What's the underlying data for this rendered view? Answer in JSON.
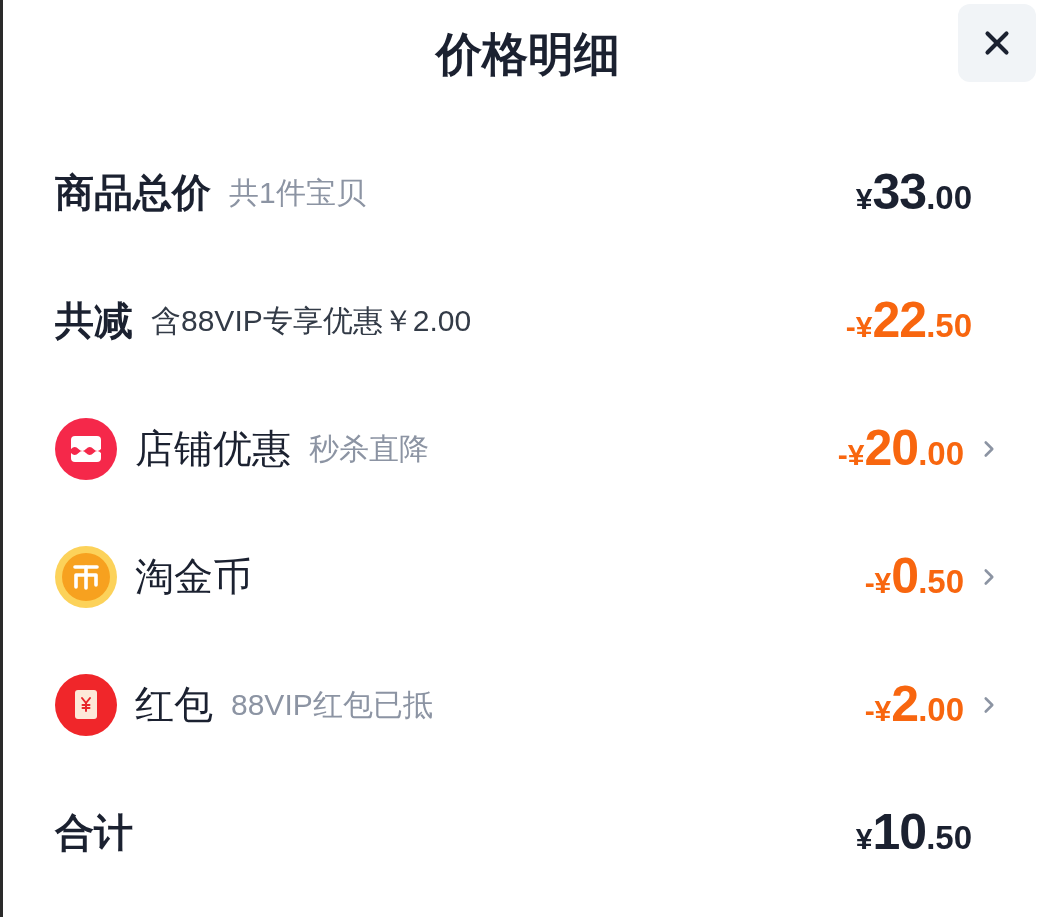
{
  "title": "价格明细",
  "rows": [
    {
      "kind": "subtotal",
      "label": "商品总价",
      "note": "共1件宝贝",
      "amount": {
        "prefix": "¥",
        "integer": "33",
        "fraction": ".00"
      }
    },
    {
      "kind": "deduction",
      "label": "共减",
      "note": "含88VIP专享优惠￥2.00",
      "amount": {
        "prefix": "-¥",
        "integer": "22",
        "fraction": ".50"
      }
    },
    {
      "kind": "shop",
      "label": "店铺优惠",
      "note": "秒杀直降",
      "amount": {
        "prefix": "-¥",
        "integer": "20",
        "fraction": ".00"
      }
    },
    {
      "kind": "coin",
      "label": "淘金币",
      "amount": {
        "prefix": "-¥",
        "integer": "0",
        "fraction": ".50"
      }
    },
    {
      "kind": "red-packet",
      "label": "红包",
      "note": "88VIP红包已抵",
      "amount": {
        "prefix": "-¥",
        "integer": "2",
        "fraction": ".00"
      }
    },
    {
      "kind": "total",
      "label": "合计",
      "amount": {
        "prefix": "¥",
        "integer": "10",
        "fraction": ".50"
      }
    }
  ]
}
